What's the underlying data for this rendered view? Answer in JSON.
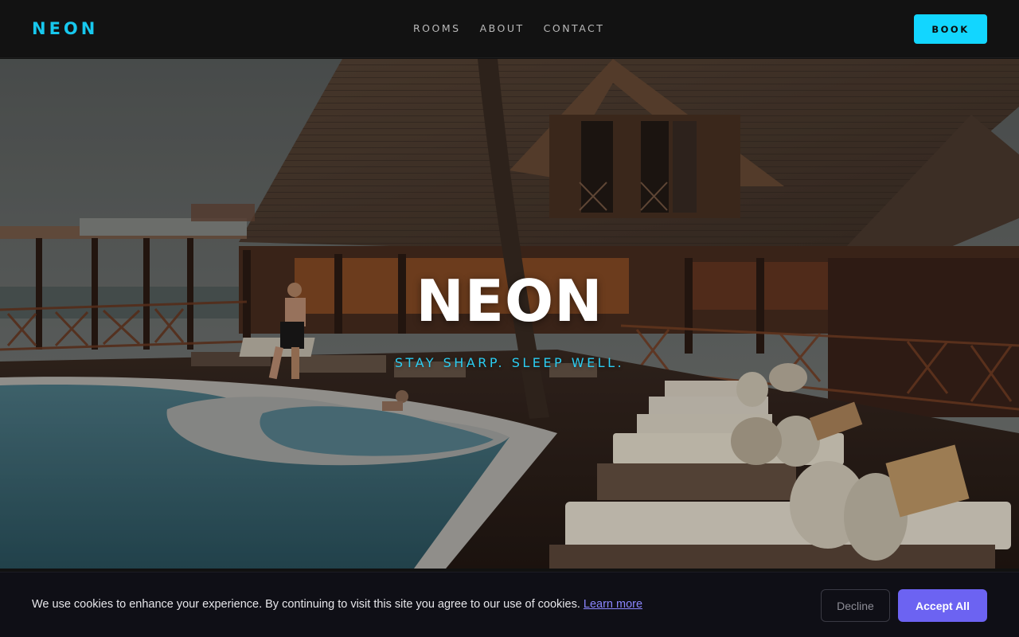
{
  "brand": {
    "logo": "NEON"
  },
  "nav": {
    "links": [
      {
        "label": "ROOMS"
      },
      {
        "label": "ABOUT"
      },
      {
        "label": "CONTACT"
      }
    ],
    "book_label": "BOOK"
  },
  "hero": {
    "title": "NEON",
    "tagline": "STAY SHARP. SLEEP WELL.",
    "image_subject": "resort-pool-lounge-photo"
  },
  "cookie_bar": {
    "message": "We use cookies to enhance your experience. By continuing to visit this site you agree to our use of cookies.",
    "learn_more": "Learn more",
    "decline_label": "Decline",
    "accept_label": "Accept All"
  },
  "colors": {
    "accent": "#12d6ff",
    "logo": "#17c8ee",
    "cookie_accent": "#6c63f2",
    "link": "#8b86ff"
  }
}
